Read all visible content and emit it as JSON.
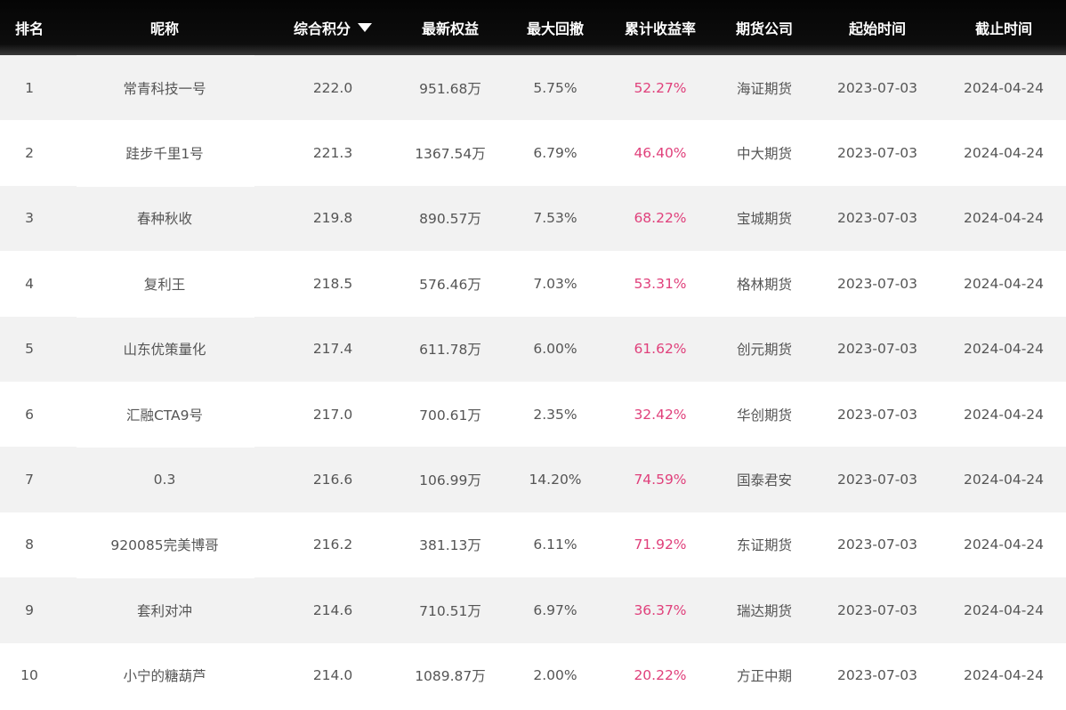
{
  "header": {
    "rank": "排名",
    "nickname": "昵称",
    "score": "综合积分",
    "equity": "最新权益",
    "drawdown": "最大回撤",
    "return": "累计收益率",
    "broker": "期货公司",
    "start": "起始时间",
    "end": "截止时间"
  },
  "accent_color": "#e0407b",
  "rows": [
    {
      "rank": "1",
      "nickname": "常青科技一号",
      "score": "222.0",
      "equity": "951.68万",
      "drawdown": "5.75%",
      "return": "52.27%",
      "broker": "海证期货",
      "start": "2023-07-03",
      "end": "2024-04-24"
    },
    {
      "rank": "2",
      "nickname": "跬步千里1号",
      "score": "221.3",
      "equity": "1367.54万",
      "drawdown": "6.79%",
      "return": "46.40%",
      "broker": "中大期货",
      "start": "2023-07-03",
      "end": "2024-04-24"
    },
    {
      "rank": "3",
      "nickname": "春种秋收",
      "score": "219.8",
      "equity": "890.57万",
      "drawdown": "7.53%",
      "return": "68.22%",
      "broker": "宝城期货",
      "start": "2023-07-03",
      "end": "2024-04-24"
    },
    {
      "rank": "4",
      "nickname": "复利王",
      "score": "218.5",
      "equity": "576.46万",
      "drawdown": "7.03%",
      "return": "53.31%",
      "broker": "格林期货",
      "start": "2023-07-03",
      "end": "2024-04-24"
    },
    {
      "rank": "5",
      "nickname": "山东优策量化",
      "score": "217.4",
      "equity": "611.78万",
      "drawdown": "6.00%",
      "return": "61.62%",
      "broker": "创元期货",
      "start": "2023-07-03",
      "end": "2024-04-24"
    },
    {
      "rank": "6",
      "nickname": "汇融CTA9号",
      "score": "217.0",
      "equity": "700.61万",
      "drawdown": "2.35%",
      "return": "32.42%",
      "broker": "华创期货",
      "start": "2023-07-03",
      "end": "2024-04-24"
    },
    {
      "rank": "7",
      "nickname": "0.3",
      "score": "216.6",
      "equity": "106.99万",
      "drawdown": "14.20%",
      "return": "74.59%",
      "broker": "国泰君安",
      "start": "2023-07-03",
      "end": "2024-04-24"
    },
    {
      "rank": "8",
      "nickname": "920085完美博哥",
      "score": "216.2",
      "equity": "381.13万",
      "drawdown": "6.11%",
      "return": "71.92%",
      "broker": "东证期货",
      "start": "2023-07-03",
      "end": "2024-04-24"
    },
    {
      "rank": "9",
      "nickname": "套利对冲",
      "score": "214.6",
      "equity": "710.51万",
      "drawdown": "6.97%",
      "return": "36.37%",
      "broker": "瑞达期货",
      "start": "2023-07-03",
      "end": "2024-04-24"
    },
    {
      "rank": "10",
      "nickname": "小宁的糖葫芦",
      "score": "214.0",
      "equity": "1089.87万",
      "drawdown": "2.00%",
      "return": "20.22%",
      "broker": "方正中期",
      "start": "2023-07-03",
      "end": "2024-04-24"
    }
  ]
}
